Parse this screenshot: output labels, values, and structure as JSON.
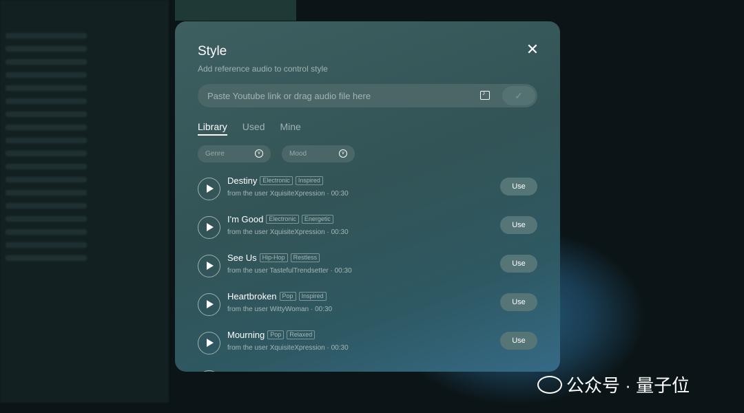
{
  "dialog": {
    "title": "Style",
    "subtitle": "Add reference audio to control style",
    "close_icon": "close-icon",
    "input_placeholder": "Paste Youtube link or drag audio file here",
    "tabs": [
      {
        "label": "Library",
        "active": true
      },
      {
        "label": "Used"
      },
      {
        "label": "Mine"
      }
    ],
    "filters": {
      "genre": "Genre",
      "mood": "Mood"
    },
    "use_label": "Use",
    "tracks": [
      {
        "title": "Destiny",
        "tags": [
          "Electronic",
          "Inspired"
        ],
        "meta": "from the user XquisiteXpression · 00:30"
      },
      {
        "title": "I'm Good",
        "tags": [
          "Electronic",
          "Energetic"
        ],
        "meta": "from the user XquisiteXpression · 00:30"
      },
      {
        "title": "See Us",
        "tags": [
          "Hip-Hop",
          "Restless"
        ],
        "meta": "from the user TastefulTrendsetter · 00:30"
      },
      {
        "title": "Heartbroken",
        "tags": [
          "Pop",
          "Inspired"
        ],
        "meta": "from the user WittyWoman · 00:30"
      },
      {
        "title": "Mourning",
        "tags": [
          "Pop",
          "Relaxed"
        ],
        "meta": "from the user XquisiteXpression · 00:30"
      }
    ]
  },
  "watermark": "公众号 · 量子位"
}
